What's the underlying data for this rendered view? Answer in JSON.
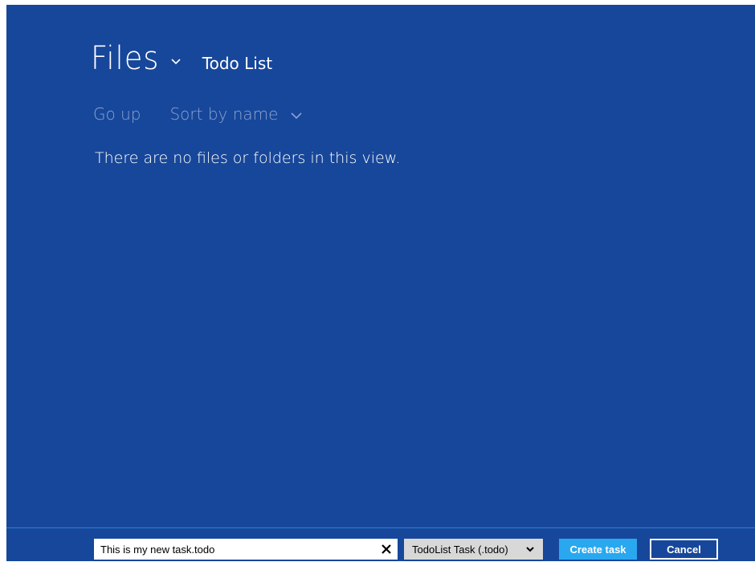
{
  "header": {
    "title": "Files",
    "location": "Todo List"
  },
  "commands": {
    "go_up": "Go up",
    "sort": "Sort by name"
  },
  "content": {
    "empty_message": "There are no files or folders in this view."
  },
  "bottom_bar": {
    "file_name_value": "This is my new task.todo",
    "file_type_selected": "TodoList Task (.todo)",
    "create_button": "Create task",
    "cancel_button": "Cancel"
  },
  "colors": {
    "background": "#17479a",
    "accent_button": "#29a8f0",
    "muted_text": "#8aa2d3"
  },
  "icons": {
    "title_dropdown": "chevron-down-icon",
    "sort_dropdown": "chevron-down-icon",
    "clear": "close-icon",
    "type_dropdown": "chevron-down-icon"
  }
}
